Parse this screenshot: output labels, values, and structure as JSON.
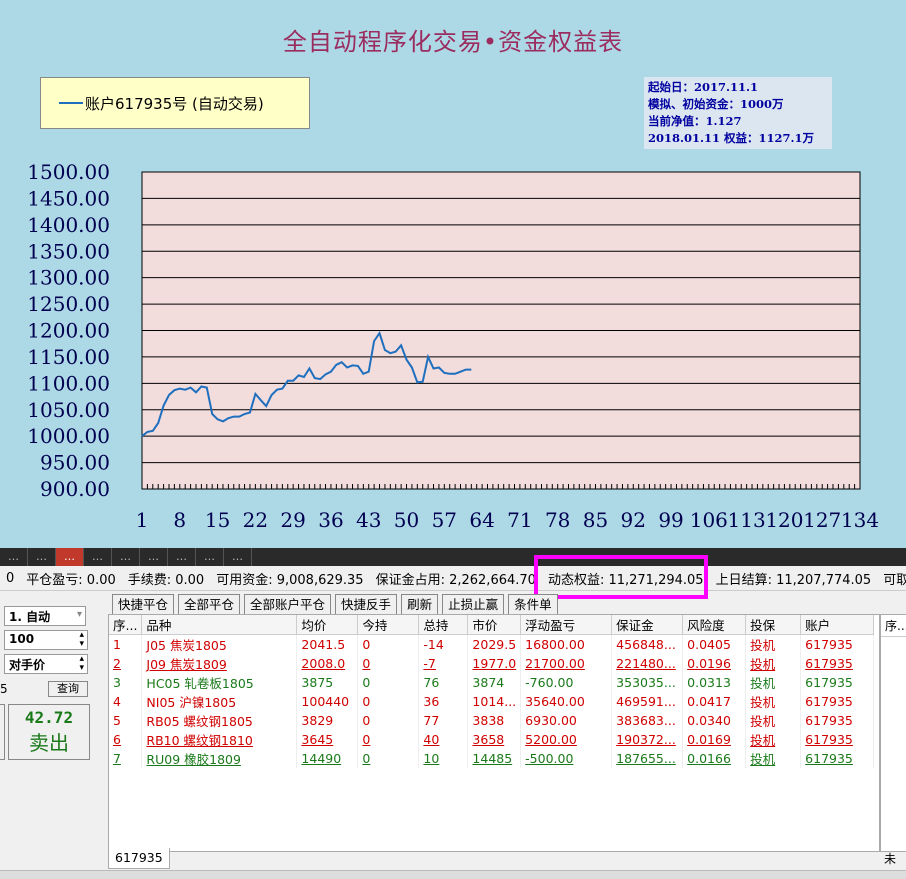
{
  "chart_area": {
    "title": "全自动程序化交易•资金权益表",
    "legend": "账户617935号 (自动交易)",
    "info": [
      "起始日：2017.11.1",
      "模拟、初始资金：1000万",
      "当前净值：1.127",
      "2018.01.11 权益：1127.1万"
    ]
  },
  "chart_data": {
    "type": "line",
    "ylim": [
      900,
      1500
    ],
    "yticks": [
      "1500.00",
      "1450.00",
      "1400.00",
      "1350.00",
      "1300.00",
      "1250.00",
      "1200.00",
      "1150.00",
      "1100.00",
      "1050.00",
      "1000.00",
      "950.00",
      "900.00"
    ],
    "xlim": [
      1,
      134
    ],
    "xticks": [
      "1",
      "8",
      "15",
      "22",
      "29",
      "36",
      "43",
      "50",
      "57",
      "64",
      "71",
      "78",
      "85",
      "92",
      "99",
      "106",
      "113",
      "120",
      "127",
      "134"
    ],
    "series": [
      {
        "name": "账户617935号 (自动交易)",
        "color": "#1f6fbf",
        "x": [
          1,
          2,
          3,
          4,
          5,
          6,
          7,
          8,
          9,
          10,
          11,
          12,
          13,
          14,
          15,
          16,
          17,
          18,
          19,
          20,
          21,
          22,
          23,
          24,
          25,
          26,
          27,
          28,
          29,
          30,
          31,
          32,
          33,
          34,
          35,
          36,
          37,
          38,
          39,
          40,
          41,
          42,
          43,
          44,
          45,
          46,
          47,
          48,
          49,
          50,
          51,
          52,
          53,
          54,
          55,
          56,
          57,
          58,
          59,
          60,
          61,
          62
        ],
        "values": [
          1000,
          1008,
          1010,
          1025,
          1058,
          1078,
          1087,
          1090,
          1088,
          1092,
          1083,
          1094,
          1092,
          1042,
          1032,
          1028,
          1034,
          1037,
          1037,
          1042,
          1045,
          1080,
          1068,
          1057,
          1078,
          1088,
          1090,
          1105,
          1105,
          1115,
          1112,
          1128,
          1110,
          1108,
          1117,
          1122,
          1135,
          1140,
          1130,
          1134,
          1133,
          1118,
          1122,
          1180,
          1195,
          1163,
          1157,
          1160,
          1172,
          1145,
          1130,
          1102,
          1103,
          1150,
          1128,
          1130,
          1120,
          1118,
          1118,
          1122,
          1126,
          1126
        ]
      }
    ]
  },
  "tabs": [
    "…",
    "…",
    "…",
    "…",
    "…",
    "…",
    "…",
    "…",
    "…"
  ],
  "account_bar": {
    "close_pnl": "0.00",
    "close_pnl_label": "平仓盈亏: 0.00",
    "fee_label": "手续费: 0.00",
    "available_label": "可用资金: 9,008,629.35",
    "margin_label": "保证金占用: 2,262,664.70",
    "equity_label": "动态权益: 11,271,294.05",
    "prev_settle_label": "上日结算: 11,207,774.05",
    "withdraw_label": "可取资金"
  },
  "left_panel": {
    "mode": "1. 自动",
    "qty": "100",
    "price_type": "对手价",
    "query": "查询",
    "prefix": "5",
    "sell_price": "42.72",
    "sell_label": "卖出"
  },
  "toolbar": [
    "快捷平仓",
    "全部平仓",
    "全部账户平仓",
    "快捷反手",
    "刷新",
    "止损止赢",
    "条件单"
  ],
  "table": {
    "headers": [
      "序...",
      "品种",
      "均价",
      "今持",
      "总持",
      "市价",
      "浮动盈亏",
      "保证金",
      "风险度",
      "投保",
      "账户"
    ],
    "rows": [
      {
        "style": "red ul-partial",
        "cells": [
          "1",
          "J05 焦炭1805",
          "2041.5",
          "0",
          "-14",
          "2029.5",
          "16800.00",
          "456848...",
          "0.0405",
          "投机",
          "617935"
        ]
      },
      {
        "style": "red",
        "cells": [
          "2",
          "J09 焦炭1809",
          "2008.0",
          "0",
          "-7",
          "1977.0",
          "21700.00",
          "221480...",
          "0.0196",
          "投机",
          "617935"
        ]
      },
      {
        "style": "green",
        "cells": [
          "3",
          "HC05 轧卷板1805",
          "3875",
          "0",
          "76",
          "3874",
          "-760.00",
          "353035...",
          "0.0313",
          "投机",
          "617935"
        ]
      },
      {
        "style": "red",
        "cells": [
          "4",
          "NI05 沪镍1805",
          "100440",
          "0",
          "36",
          "1014...",
          "35640.00",
          "469591...",
          "0.0417",
          "投机",
          "617935"
        ]
      },
      {
        "style": "red",
        "cells": [
          "5",
          "RB05 螺纹钢1805",
          "3829",
          "0",
          "77",
          "3838",
          "6930.00",
          "383683...",
          "0.0340",
          "投机",
          "617935"
        ]
      },
      {
        "style": "red",
        "cells": [
          "6",
          "RB10 螺纹钢1810",
          "3645",
          "0",
          "40",
          "3658",
          "5200.00",
          "190372...",
          "0.0169",
          "投机",
          "617935"
        ]
      },
      {
        "style": "green",
        "cells": [
          "7",
          "RU09 橡胶1809",
          "14490",
          "0",
          "10",
          "14485",
          "-500.00",
          "187655...",
          "0.0166",
          "投机",
          "617935"
        ]
      }
    ]
  },
  "right_panel_header": "序...",
  "account_tab": "617935",
  "end_tab": "未"
}
